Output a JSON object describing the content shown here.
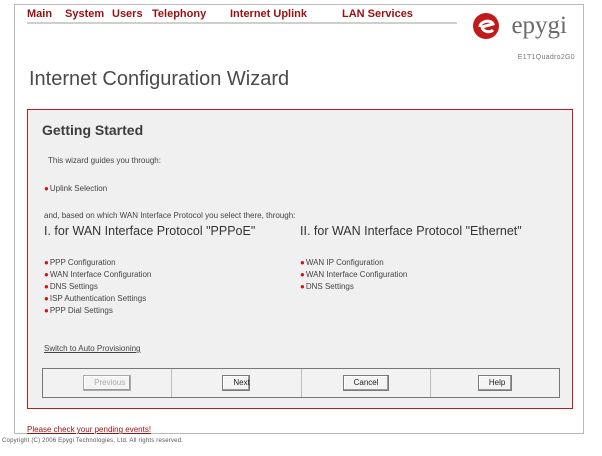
{
  "nav": {
    "items": [
      "Main",
      "System",
      "Users",
      "Telephony",
      "Internet Uplink",
      "LAN Services"
    ]
  },
  "brand": {
    "logo_text": "epygi",
    "model": "E1T1Quadro2G0"
  },
  "page_title": "Internet Configuration Wizard",
  "panel": {
    "title": "Getting Started",
    "intro": "This wizard guides you through:",
    "uplink_bullet": "Uplink Selection",
    "based_on": "and, based on which WAN Interface Protocol you select there, through:",
    "col1": {
      "title": "I. for WAN Interface Protocol \"PPPoE\"",
      "items": [
        "PPP Configuration",
        "WAN Interface Configuration",
        "DNS Settings",
        "ISP Authentication Settings",
        "PPP Dial Settings"
      ]
    },
    "col2": {
      "title": "II. for WAN Interface Protocol \"Ethernet\"",
      "items": [
        "WAN IP Configuration",
        "WAN Interface Configuration",
        "DNS Settings"
      ]
    },
    "auto_provisioning_link": "Switch to Auto Provisioning"
  },
  "buttons": {
    "previous": "Previous",
    "next": "Next",
    "cancel": "Cancel",
    "help": "Help"
  },
  "footer": {
    "pending_events": "Please check your pending events!",
    "copyright": "Copyright (C) 2006 Epygi Technologies, Ltd. All rights reserved."
  },
  "colors": {
    "accent": "#c21a1a",
    "nav_text": "#9a0f0f"
  }
}
